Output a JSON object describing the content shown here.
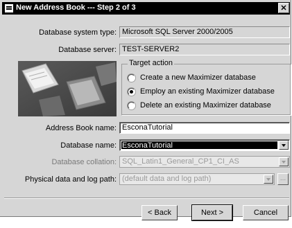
{
  "window": {
    "title": "New Address Book --- Step 2 of 3",
    "close_glyph": "✕"
  },
  "form": {
    "db_system_type_label": "Database system type:",
    "db_system_type_value": "Microsoft SQL Server 2000/2005",
    "db_server_label": "Database server:",
    "db_server_value": "TEST-SERVER2",
    "address_book_name_label": "Address Book name:",
    "address_book_name_value": "EsconaTutorial",
    "database_name_label": "Database name:",
    "database_name_value": "EsconaTutorial",
    "collation_label": "Database collation:",
    "collation_value": "SQL_Latin1_General_CP1_CI_AS",
    "path_label": "Physical data and log path:",
    "path_value": "(default data and log path)",
    "browse_label": "..."
  },
  "target_action": {
    "title": "Target action",
    "options": [
      {
        "label": "Create a new Maximizer database",
        "selected": false
      },
      {
        "label": "Employ an existing Maximizer database",
        "selected": true
      },
      {
        "label": "Delete an existing Maximizer database",
        "selected": false
      }
    ]
  },
  "buttons": {
    "back": "< Back",
    "next": "Next >",
    "cancel": "Cancel"
  },
  "colors": {
    "dialog_bg": "#d6d6d6",
    "title_bg": "#000000",
    "selection": "#000000"
  }
}
